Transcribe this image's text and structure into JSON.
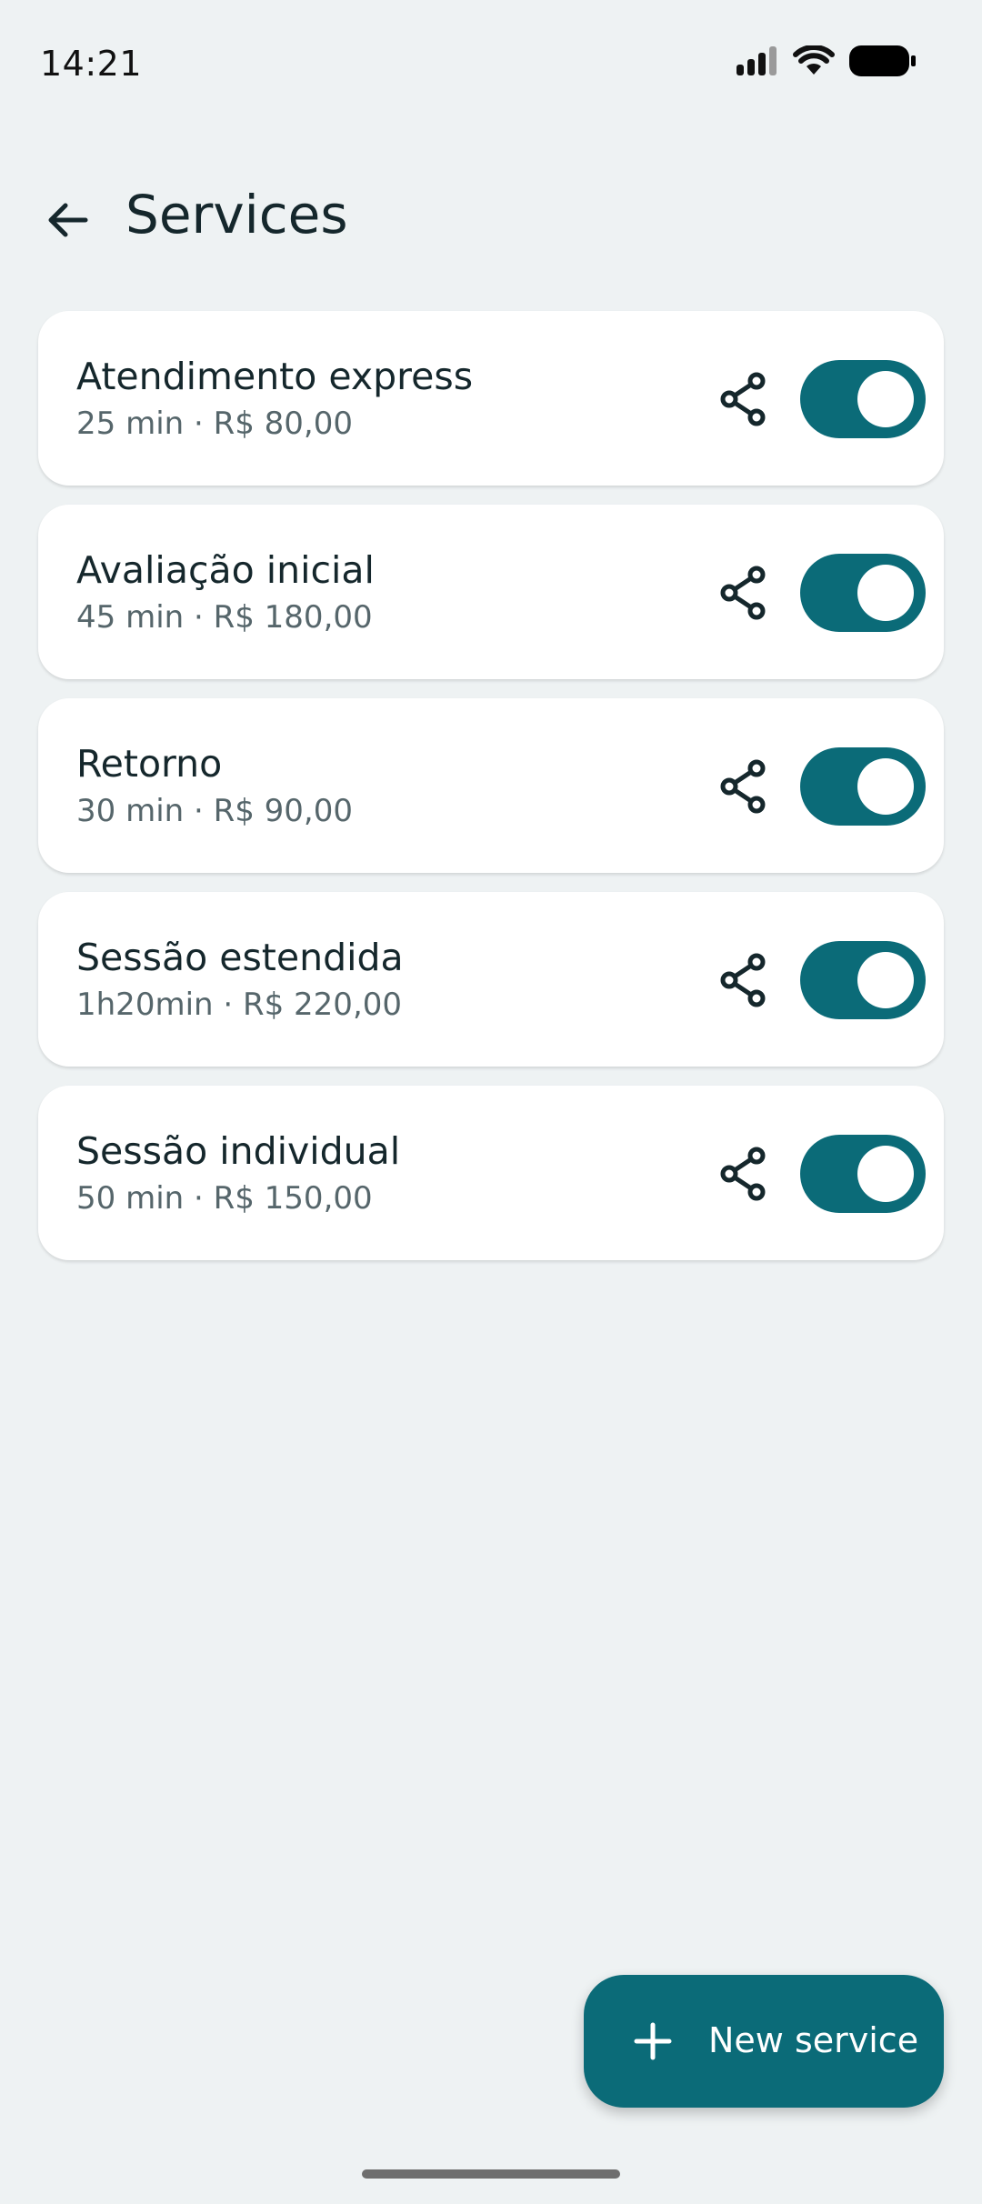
{
  "status_bar": {
    "time": "14:21",
    "icons": [
      "signal-icon",
      "wifi-icon",
      "battery-icon"
    ]
  },
  "header": {
    "back_icon": "arrow-back-icon",
    "title": "Services"
  },
  "services": [
    {
      "name": "Atendimento express",
      "details": "25 min · R$ 80,00",
      "enabled": true
    },
    {
      "name": "Avaliação inicial",
      "details": "45 min · R$ 180,00",
      "enabled": true
    },
    {
      "name": "Retorno",
      "details": "30 min · R$ 90,00",
      "enabled": true
    },
    {
      "name": "Sessão estendida",
      "details": "1h20min · R$ 220,00",
      "enabled": true
    },
    {
      "name": "Sessão individual",
      "details": "50 min · R$ 150,00",
      "enabled": true
    }
  ],
  "fab": {
    "icon": "plus-icon",
    "label": "New service"
  },
  "colors": {
    "background": "#eef2f3",
    "accent": "#0b6b78",
    "card": "#ffffff",
    "title_text": "#15272c",
    "secondary_text": "#56666b"
  }
}
